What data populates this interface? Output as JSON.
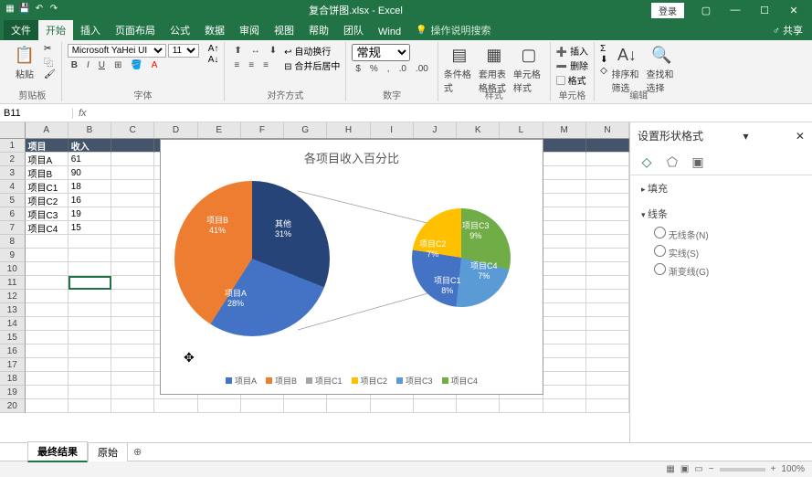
{
  "titlebar": {
    "title": "复合饼图.xlsx - Excel",
    "login": "登录"
  },
  "tabs": {
    "file": "文件",
    "home": "开始",
    "insert": "插入",
    "pagelayout": "页面布局",
    "formulas": "公式",
    "data": "数据",
    "review": "审阅",
    "view": "视图",
    "help": "帮助",
    "team": "团队",
    "wind": "Wind",
    "tellme": "操作说明搜索",
    "share": "共享"
  },
  "ribbon": {
    "clipboard": {
      "label": "剪贴板",
      "paste": "粘贴"
    },
    "font": {
      "label": "字体",
      "name": "Microsoft YaHei UI",
      "size": "11"
    },
    "alignment": {
      "label": "对齐方式",
      "wrap": "自动换行",
      "merge": "合并后居中"
    },
    "number": {
      "label": "数字",
      "format": "常规"
    },
    "styles": {
      "label": "样式",
      "cond": "条件格式",
      "table": "套用表格格式",
      "cell": "单元格样式"
    },
    "cells": {
      "label": "单元格",
      "insert": "插入",
      "delete": "删除",
      "format": "格式"
    },
    "editing": {
      "label": "编辑",
      "sort": "排序和筛选",
      "find": "查找和选择"
    }
  },
  "namebox": "B11",
  "columns": [
    "A",
    "B",
    "C",
    "D",
    "E",
    "F",
    "G",
    "H",
    "I",
    "J",
    "K",
    "L",
    "M",
    "N"
  ],
  "table": {
    "headers": [
      "项目",
      "收入"
    ],
    "rows": [
      [
        "项目A",
        "61"
      ],
      [
        "项目B",
        "90"
      ],
      [
        "项目C1",
        "18"
      ],
      [
        "项目C2",
        "16"
      ],
      [
        "项目C3",
        "19"
      ],
      [
        "项目C4",
        "15"
      ]
    ],
    "max_rows": 20
  },
  "chart_data": {
    "type": "pie",
    "title": "各项目收入百分比",
    "main_pie": [
      {
        "name": "项目A",
        "pct": 28,
        "color": "#4472c4"
      },
      {
        "name": "项目B",
        "pct": 41,
        "color": "#ed7d31"
      },
      {
        "name": "其他",
        "pct": 31,
        "color": "#264478"
      }
    ],
    "secondary_pie": [
      {
        "name": "项目C1",
        "pct": 8,
        "color": "#4472c4"
      },
      {
        "name": "项目C2",
        "pct": 7,
        "color": "#ffc000"
      },
      {
        "name": "项目C3",
        "pct": 9,
        "color": "#70ad47"
      },
      {
        "name": "项目C4",
        "pct": 7,
        "color": "#5b9bd5"
      }
    ],
    "legend": [
      {
        "name": "项目A",
        "color": "#4472c4"
      },
      {
        "name": "项目B",
        "color": "#ed7d31"
      },
      {
        "name": "项目C1",
        "color": "#a5a5a5"
      },
      {
        "name": "项目C2",
        "color": "#ffc000"
      },
      {
        "name": "项目C3",
        "color": "#5b9bd5"
      },
      {
        "name": "项目C4",
        "color": "#70ad47"
      }
    ]
  },
  "sidepane": {
    "title": "设置形状格式",
    "sections": {
      "fill": "填充",
      "line": "线条",
      "opts": {
        "noline": "无线条(N)",
        "solid": "实线(S)",
        "gradient": "渐变线(G)"
      }
    }
  },
  "sheettabs": {
    "active": "最终结果",
    "other": "原始"
  },
  "statusbar": {
    "zoom": "100%"
  }
}
